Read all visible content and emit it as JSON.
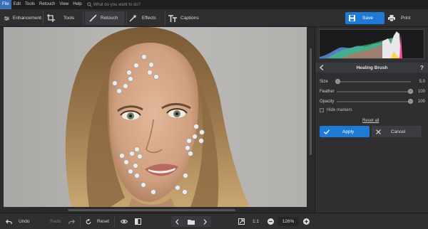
{
  "menu": {
    "items": [
      "File",
      "Edit",
      "Tools",
      "Retouch",
      "View",
      "Help"
    ],
    "search_placeholder": "What do you want to do?"
  },
  "toolbar": {
    "enhancement": "Enhancement",
    "tools": "Tools",
    "retouch": "Retouch",
    "effects": "Effects",
    "captions": "Captions",
    "save": "Save",
    "print": "Print"
  },
  "panel": {
    "title": "Healing Brush",
    "sliders": [
      {
        "label": "Size",
        "value": "5,0",
        "fraction": 0.02
      },
      {
        "label": "Feather",
        "value": "100",
        "fraction": 1.0
      },
      {
        "label": "Opacity",
        "value": "100",
        "fraction": 1.0
      }
    ],
    "hide_markers": "Hide markers",
    "reset_all": "Reset all",
    "apply": "Apply",
    "cancel": "Cancel"
  },
  "bottom": {
    "undo": "Undo",
    "redo": "Redo",
    "reset": "Reset",
    "ratio": "1:1",
    "zoom": "126%"
  },
  "colors": {
    "accent": "#1f7ad6",
    "marker": "#e8e8e8"
  }
}
